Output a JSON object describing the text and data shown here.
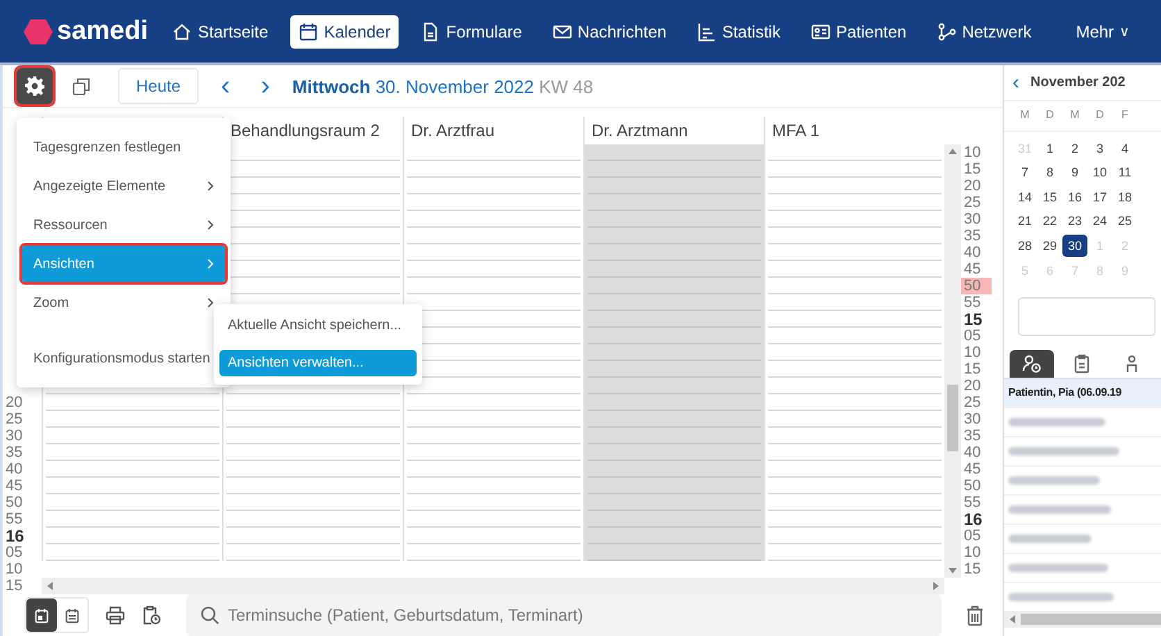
{
  "navbar": {
    "logo_text": "samedi",
    "items": [
      {
        "label": "Startseite",
        "selected": false
      },
      {
        "label": "Kalender",
        "selected": true
      },
      {
        "label": "Formulare",
        "selected": false
      },
      {
        "label": "Nachrichten",
        "selected": false
      },
      {
        "label": "Statistik",
        "selected": false
      },
      {
        "label": "Patienten",
        "selected": false
      },
      {
        "label": "Netzwerk",
        "selected": false
      }
    ],
    "more": {
      "label": "Mehr",
      "caret": "∨"
    }
  },
  "toolbar": {
    "settings_highlighted": true,
    "today": "Heute",
    "prev": "‹",
    "next": "›",
    "weekday": "Mittwoch",
    "date": "30. November 2022",
    "week": "KW 48"
  },
  "columns": [
    {
      "unavailable": false
    },
    {
      "title": "Behandlungsraum 2",
      "unavailable": false
    },
    {
      "title": "Dr. Arztfrau",
      "unavailable": false
    },
    {
      "title": "Dr. Arztmann",
      "unavailable": true
    },
    {
      "title": "MFA 1",
      "unavailable": false
    }
  ],
  "left_time_labels": [
    {
      "label": "20",
      "kind": "minute"
    },
    {
      "label": "25",
      "kind": "minute"
    },
    {
      "label": "30",
      "kind": "minute"
    },
    {
      "label": "35",
      "kind": "minute"
    },
    {
      "label": "40",
      "kind": "minute"
    },
    {
      "label": "45",
      "kind": "minute"
    },
    {
      "label": "50",
      "kind": "minute"
    },
    {
      "label": "55",
      "kind": "minute"
    },
    {
      "label": "16",
      "kind": "hour"
    },
    {
      "label": "05",
      "kind": "minute"
    },
    {
      "label": "10",
      "kind": "minute"
    },
    {
      "label": "15",
      "kind": "minute"
    }
  ],
  "right_time_labels": [
    {
      "label": "10",
      "kind": "minute",
      "current": false
    },
    {
      "label": "15",
      "kind": "minute",
      "current": false
    },
    {
      "label": "20",
      "kind": "minute",
      "current": false
    },
    {
      "label": "25",
      "kind": "minute",
      "current": false
    },
    {
      "label": "30",
      "kind": "minute",
      "current": false
    },
    {
      "label": "35",
      "kind": "minute",
      "current": false
    },
    {
      "label": "40",
      "kind": "minute",
      "current": false
    },
    {
      "label": "45",
      "kind": "minute",
      "current": false
    },
    {
      "label": "50",
      "kind": "minute",
      "current": true
    },
    {
      "label": "55",
      "kind": "minute",
      "current": false
    },
    {
      "label": "15",
      "kind": "hour",
      "current": false
    },
    {
      "label": "05",
      "kind": "minute",
      "current": false
    },
    {
      "label": "10",
      "kind": "minute",
      "current": false
    },
    {
      "label": "15",
      "kind": "minute",
      "current": false
    },
    {
      "label": "20",
      "kind": "minute",
      "current": false
    },
    {
      "label": "25",
      "kind": "minute",
      "current": false
    },
    {
      "label": "30",
      "kind": "minute",
      "current": false
    },
    {
      "label": "35",
      "kind": "minute",
      "current": false
    },
    {
      "label": "40",
      "kind": "minute",
      "current": false
    },
    {
      "label": "45",
      "kind": "minute",
      "current": false
    },
    {
      "label": "50",
      "kind": "minute",
      "current": false
    },
    {
      "label": "55",
      "kind": "minute",
      "current": false
    },
    {
      "label": "16",
      "kind": "hour",
      "current": false
    },
    {
      "label": "05",
      "kind": "minute",
      "current": false
    },
    {
      "label": "10",
      "kind": "minute",
      "current": false
    },
    {
      "label": "15",
      "kind": "minute",
      "current": false
    }
  ],
  "menu": {
    "items": [
      {
        "label": "Tagesgrenzen festlegen",
        "submenu": false,
        "selected": false,
        "highlighted": false
      },
      {
        "label": "Angezeigte Elemente",
        "submenu": true,
        "selected": false,
        "highlighted": false
      },
      {
        "label": "Ressourcen",
        "submenu": true,
        "selected": false,
        "highlighted": false
      },
      {
        "label": "Ansichten",
        "submenu": true,
        "selected": true,
        "highlighted": true
      },
      {
        "label": "Zoom",
        "submenu": true,
        "selected": false,
        "highlighted": false
      },
      {
        "label": "Konfigurationsmodus starten",
        "submenu": false,
        "selected": false,
        "highlighted": false
      }
    ],
    "submenu": [
      {
        "label": "Aktuelle Ansicht speichern...",
        "selected": false
      },
      {
        "label": "Ansichten verwalten...",
        "selected": true
      }
    ]
  },
  "bottom_bar": {
    "views": [
      {
        "selected": true
      },
      {
        "selected": false
      }
    ],
    "search_placeholder": "Terminsuche (Patient, Geburtsdatum, Terminart)"
  },
  "mini_calendar": {
    "prev": "‹",
    "month": "November 202",
    "weekdays": [
      "M",
      "D",
      "M",
      "D",
      "F"
    ],
    "weeks": [
      [
        {
          "d": "31",
          "muted": true,
          "selected": false
        },
        {
          "d": "1",
          "muted": false,
          "selected": false
        },
        {
          "d": "2",
          "muted": false,
          "selected": false
        },
        {
          "d": "3",
          "muted": false,
          "selected": false
        },
        {
          "d": "4",
          "muted": false,
          "selected": false
        }
      ],
      [
        {
          "d": "7",
          "muted": false,
          "selected": false
        },
        {
          "d": "8",
          "muted": false,
          "selected": false
        },
        {
          "d": "9",
          "muted": false,
          "selected": false
        },
        {
          "d": "10",
          "muted": false,
          "selected": false
        },
        {
          "d": "11",
          "muted": false,
          "selected": false
        }
      ],
      [
        {
          "d": "14",
          "muted": false,
          "selected": false
        },
        {
          "d": "15",
          "muted": false,
          "selected": false
        },
        {
          "d": "16",
          "muted": false,
          "selected": false
        },
        {
          "d": "17",
          "muted": false,
          "selected": false
        },
        {
          "d": "18",
          "muted": false,
          "selected": false
        }
      ],
      [
        {
          "d": "21",
          "muted": false,
          "selected": false
        },
        {
          "d": "22",
          "muted": false,
          "selected": false
        },
        {
          "d": "23",
          "muted": false,
          "selected": false
        },
        {
          "d": "24",
          "muted": false,
          "selected": false
        },
        {
          "d": "25",
          "muted": false,
          "selected": false
        }
      ],
      [
        {
          "d": "28",
          "muted": false,
          "selected": false
        },
        {
          "d": "29",
          "muted": false,
          "selected": false
        },
        {
          "d": "30",
          "muted": false,
          "selected": true
        },
        {
          "d": "1",
          "muted": true,
          "selected": false
        },
        {
          "d": "2",
          "muted": true,
          "selected": false
        }
      ],
      [
        {
          "d": "5",
          "muted": true,
          "selected": false
        },
        {
          "d": "6",
          "muted": true,
          "selected": false
        },
        {
          "d": "7",
          "muted": true,
          "selected": false
        },
        {
          "d": "8",
          "muted": true,
          "selected": false
        },
        {
          "d": "9",
          "muted": true,
          "selected": false
        }
      ]
    ]
  },
  "side_tabs": [
    {
      "selected": true
    },
    {
      "selected": false
    },
    {
      "selected": false
    }
  ],
  "patients": [
    {
      "name": "Patientin, Pia (06.09.19",
      "blurred": false
    },
    {
      "blurred": true
    },
    {
      "blurred": true
    },
    {
      "blurred": true
    },
    {
      "blurred": true
    },
    {
      "blurred": true
    },
    {
      "blurred": true
    },
    {
      "blurred": true
    }
  ]
}
